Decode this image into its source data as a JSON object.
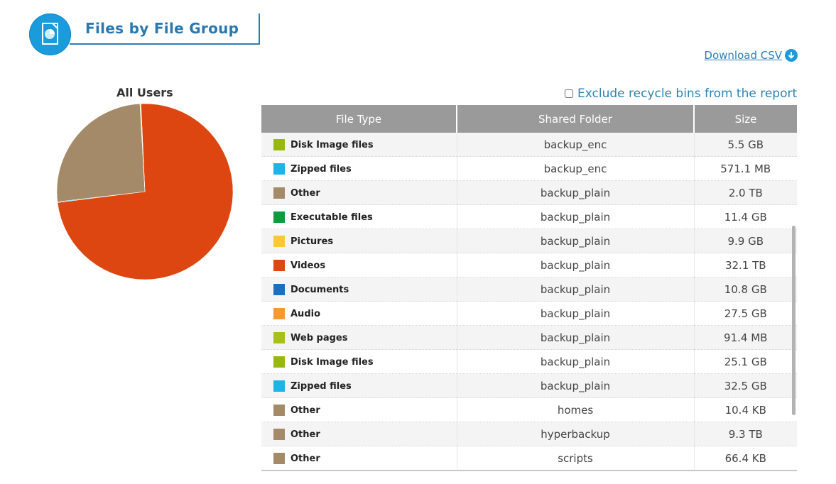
{
  "header": {
    "title": "Files by File Group",
    "icon": "report-pie-icon",
    "accent": "#1a9bdc"
  },
  "download": {
    "label": "Download CSV",
    "icon": "download-icon"
  },
  "pie": {
    "title": "All Users"
  },
  "options": {
    "exclude_recycle_label": "Exclude recycle bins from the report",
    "exclude_recycle_checked": false
  },
  "table": {
    "columns": [
      "File Type",
      "Shared Folder",
      "Size"
    ],
    "rows": [
      {
        "type": "Disk Image files",
        "color": "#97b80f",
        "folder": "backup_enc",
        "size": "5.5 GB"
      },
      {
        "type": "Zipped files",
        "color": "#1db4e6",
        "folder": "backup_enc",
        "size": "571.1 MB"
      },
      {
        "type": "Other",
        "color": "#a48a69",
        "folder": "backup_plain",
        "size": "2.0 TB"
      },
      {
        "type": "Executable files",
        "color": "#0d9c3e",
        "folder": "backup_plain",
        "size": "11.4 GB"
      },
      {
        "type": "Pictures",
        "color": "#f7c933",
        "folder": "backup_plain",
        "size": "9.9 GB"
      },
      {
        "type": "Videos",
        "color": "#dd4610",
        "folder": "backup_plain",
        "size": "32.1 TB"
      },
      {
        "type": "Documents",
        "color": "#1a6fc1",
        "folder": "backup_plain",
        "size": "10.8 GB"
      },
      {
        "type": "Audio",
        "color": "#f79831",
        "folder": "backup_plain",
        "size": "27.5 GB"
      },
      {
        "type": "Web pages",
        "color": "#a7c118",
        "folder": "backup_plain",
        "size": "91.4 MB"
      },
      {
        "type": "Disk Image files",
        "color": "#97b80f",
        "folder": "backup_plain",
        "size": "25.1 GB"
      },
      {
        "type": "Zipped files",
        "color": "#1db4e6",
        "folder": "backup_plain",
        "size": "32.5 GB"
      },
      {
        "type": "Other",
        "color": "#a48a69",
        "folder": "homes",
        "size": "10.4 KB"
      },
      {
        "type": "Other",
        "color": "#a48a69",
        "folder": "hyperbackup",
        "size": "9.3 TB"
      },
      {
        "type": "Other",
        "color": "#a48a69",
        "folder": "scripts",
        "size": "66.4 KB"
      }
    ]
  },
  "chart_data": {
    "type": "pie",
    "title": "All Users",
    "slices": [
      {
        "name": "Videos",
        "value": 32.1,
        "color": "#dd4610"
      },
      {
        "name": "Zipped files",
        "value": 0.06,
        "color": "#1db4e6"
      },
      {
        "name": "Other",
        "value": 11.3,
        "color": "#a48a69"
      },
      {
        "name": "Pictures",
        "value": 0.05,
        "color": "#f7c933"
      },
      {
        "name": "Disk Image files",
        "value": 0.03,
        "color": "#97b80f"
      }
    ]
  }
}
